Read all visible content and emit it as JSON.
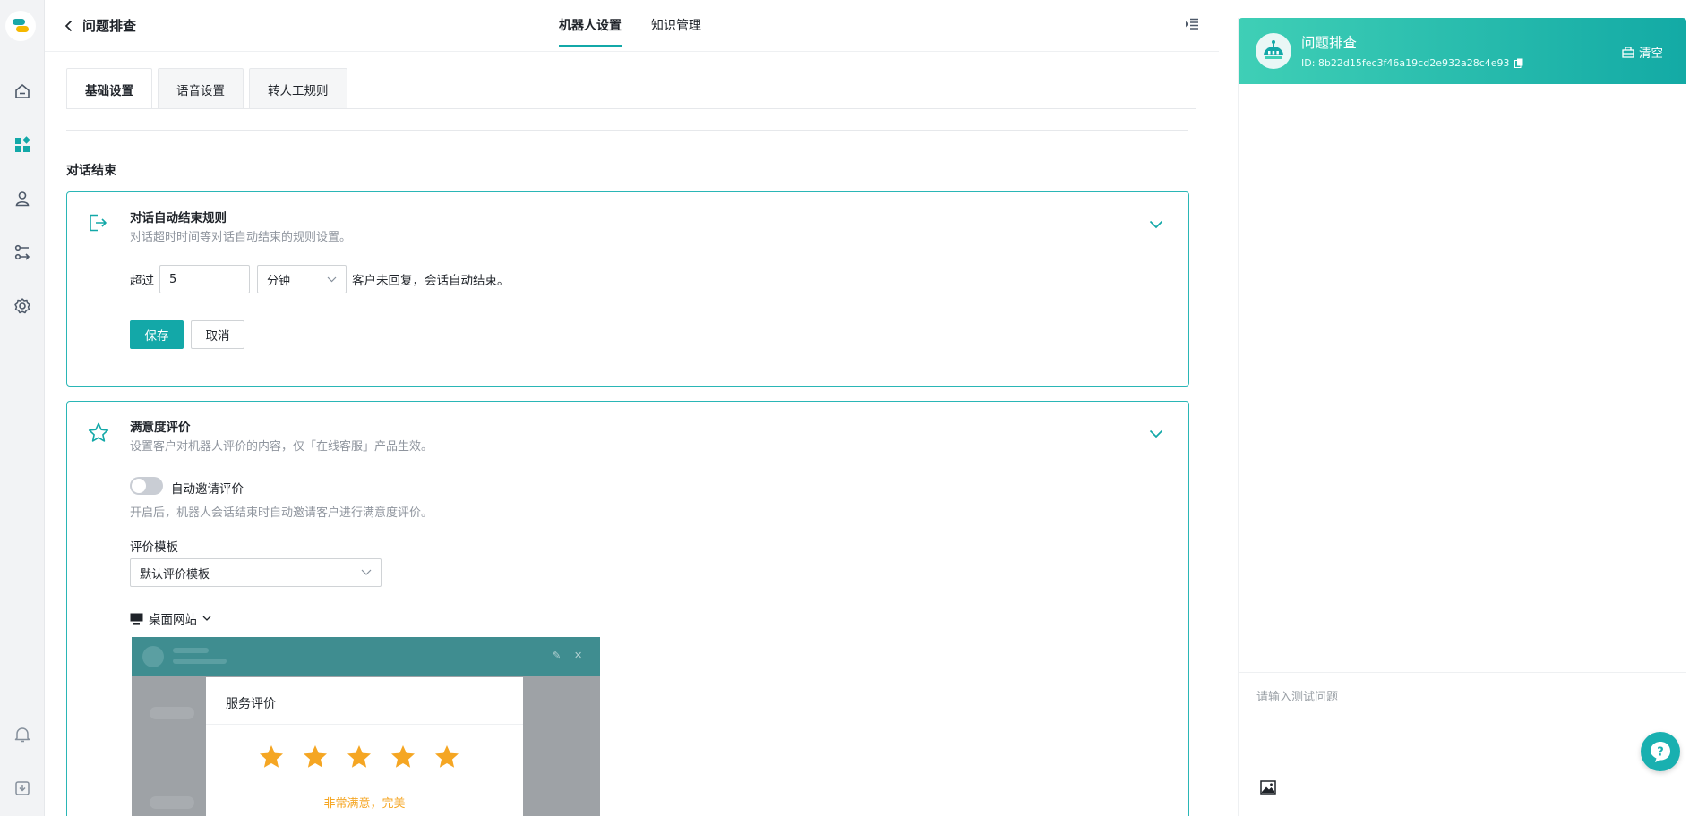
{
  "header": {
    "back_title": "问题排查",
    "tabs": [
      {
        "label": "机器人设置",
        "active": true
      },
      {
        "label": "知识管理",
        "active": false
      }
    ]
  },
  "subtabs": [
    {
      "label": "基础设置",
      "active": true
    },
    {
      "label": "语音设置",
      "active": false
    },
    {
      "label": "转人工规则",
      "active": false
    }
  ],
  "section_title": "对话结束",
  "end_rule": {
    "title": "对话自动结束规则",
    "desc": "对话超时时间等对话自动结束的规则设置。",
    "prefix": "超过",
    "minutes_value": "5",
    "unit_value": "分钟",
    "suffix": "客户未回复，会话自动结束。",
    "save_label": "保存",
    "cancel_label": "取消"
  },
  "satisfaction": {
    "title": "满意度评价",
    "desc": "设置客户对机器人评价的内容，仅「在线客服」产品生效。",
    "toggle_label": "自动邀请评价",
    "toggle_on": false,
    "toggle_desc": "开启后，机器人会话结束时自动邀请客户进行满意度评价。",
    "template_label": "评价模板",
    "template_value": "默认评价模板",
    "device_label": "桌面网站",
    "preview": {
      "dialog_title": "服务评价",
      "rating": 5,
      "max_rating": 5,
      "rating_text": "非常满意，完美"
    }
  },
  "chat_panel": {
    "title": "问题排查",
    "id_text": "ID: 8b22d15fec3f46a19cd2e932a28c4e93",
    "clear_label": "清空",
    "input_placeholder": "请输入测试问题"
  },
  "colors": {
    "accent": "#13a8a8",
    "star": "#f5a623",
    "header_gradient_start": "#3fcfb6",
    "header_gradient_end": "#13aaa5"
  },
  "icons": {
    "rail": [
      "home-icon",
      "dashboard-icon",
      "user-icon",
      "flow-icon",
      "settings-icon",
      "bell-icon",
      "download-icon"
    ]
  }
}
